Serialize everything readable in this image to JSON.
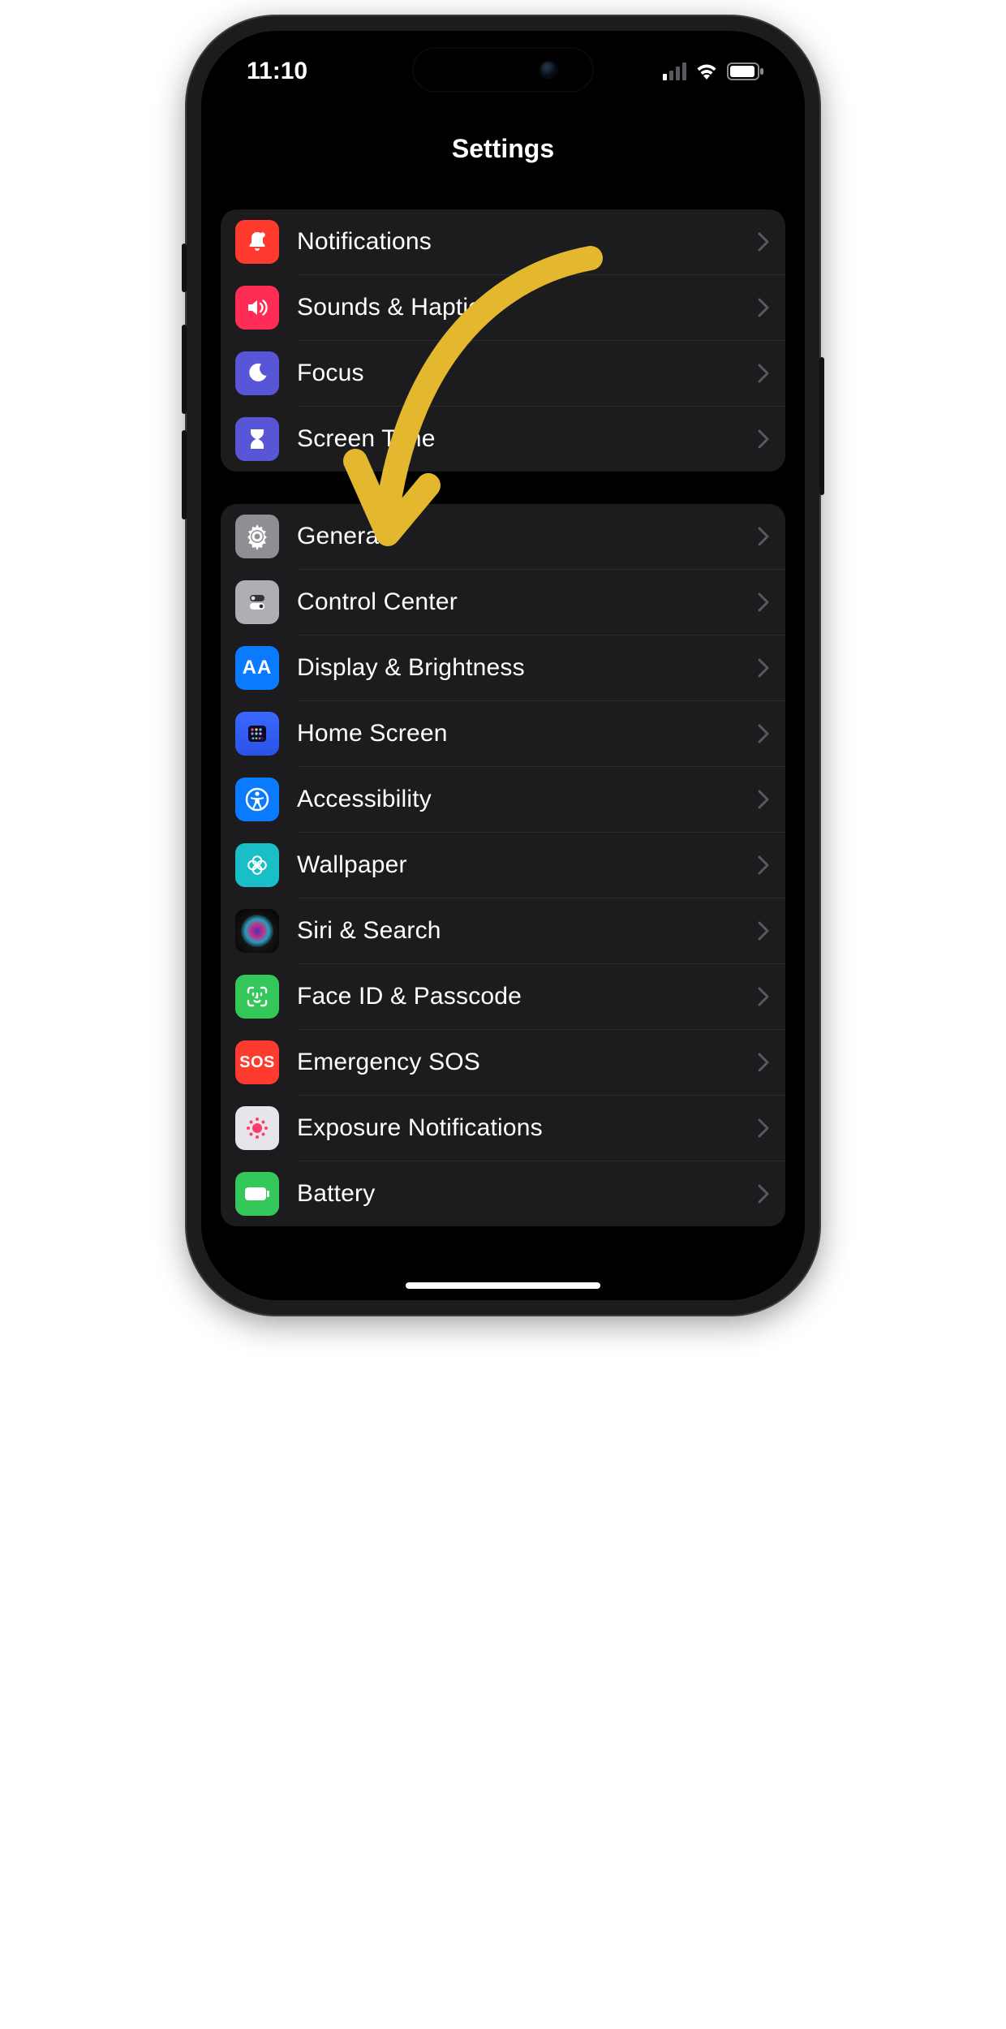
{
  "status": {
    "time": "11:10"
  },
  "header": {
    "title": "Settings"
  },
  "group1": [
    {
      "key": "notifications",
      "label": "Notifications"
    },
    {
      "key": "sounds",
      "label": "Sounds & Haptics"
    },
    {
      "key": "focus",
      "label": "Focus"
    },
    {
      "key": "screentime",
      "label": "Screen Time"
    }
  ],
  "group2": [
    {
      "key": "general",
      "label": "General"
    },
    {
      "key": "control",
      "label": "Control Center"
    },
    {
      "key": "display",
      "label": "Display & Brightness"
    },
    {
      "key": "homescreen",
      "label": "Home Screen"
    },
    {
      "key": "accessibility",
      "label": "Accessibility"
    },
    {
      "key": "wallpaper",
      "label": "Wallpaper"
    },
    {
      "key": "siri",
      "label": "Siri & Search"
    },
    {
      "key": "faceid",
      "label": "Face ID & Passcode"
    },
    {
      "key": "sos",
      "label": "Emergency SOS",
      "sosText": "SOS"
    },
    {
      "key": "exposure",
      "label": "Exposure Notifications"
    },
    {
      "key": "battery",
      "label": "Battery"
    }
  ],
  "annotation": {
    "target": "general"
  }
}
